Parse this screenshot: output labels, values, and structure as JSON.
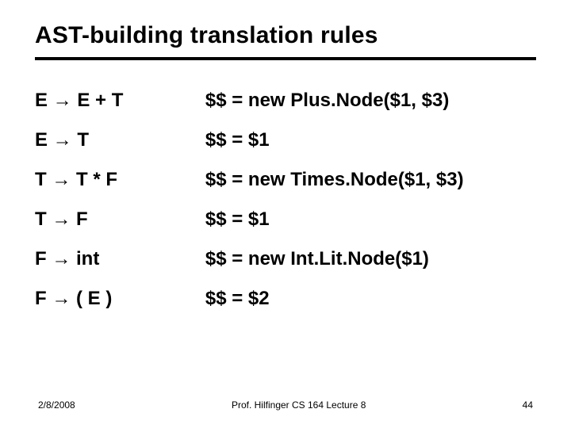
{
  "title": "AST-building translation rules",
  "rules": [
    {
      "lhs": "E → E + T",
      "rhs": "$$ = new Plus.Node($1, $3)"
    },
    {
      "lhs": "E → T",
      "rhs": "$$ = $1"
    },
    {
      "lhs": "T → T * F",
      "rhs": "$$ = new Times.Node($1, $3)"
    },
    {
      "lhs": "T → F",
      "rhs": "$$ = $1"
    },
    {
      "lhs": "F → int",
      "rhs": "$$ = new Int.Lit.Node($1)"
    },
    {
      "lhs": "F → ( E )",
      "rhs": "$$ = $2"
    }
  ],
  "footer": {
    "date": "2/8/2008",
    "center": "Prof. Hilfinger CS 164 Lecture 8",
    "page": "44"
  }
}
